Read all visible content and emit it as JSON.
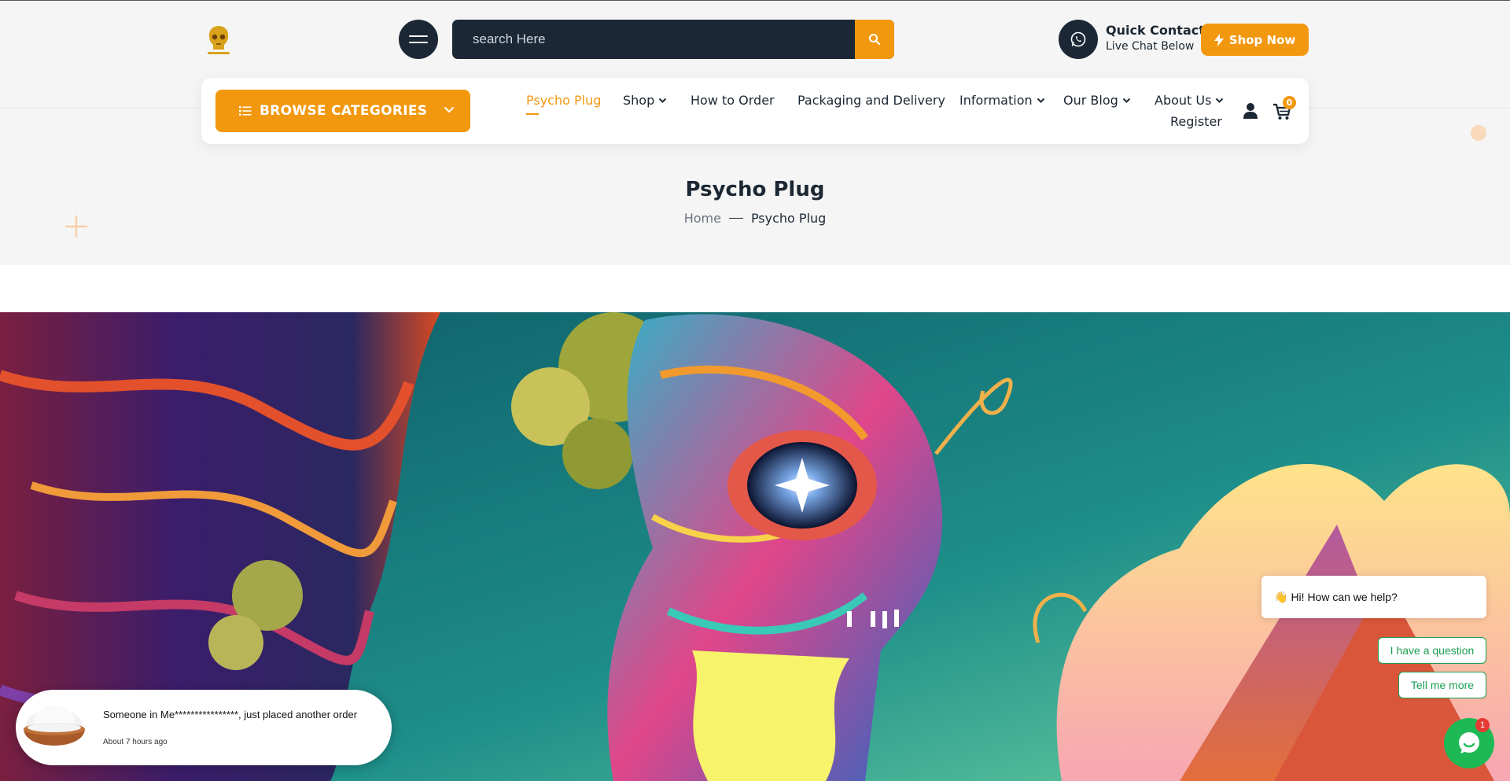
{
  "header": {
    "logo_icon": "skull-logo-icon",
    "search": {
      "placeholder": "search Here"
    },
    "quick_contact": {
      "title": "Quick Contact",
      "subtitle": "Live Chat Below"
    },
    "shop_now_label": "Shop Now"
  },
  "nav": {
    "browse_label": "BROWSE CATEGORIES",
    "items": [
      {
        "label": "Psycho Plug",
        "active": true
      },
      {
        "label": "Shop",
        "dropdown": true
      },
      {
        "label": "How to Order"
      },
      {
        "label": "Packaging and Delivery"
      },
      {
        "label": "Information",
        "dropdown": true
      },
      {
        "label": "Our Blog",
        "dropdown": true
      },
      {
        "label": "About Us",
        "dropdown": true
      }
    ],
    "register_label": "Register",
    "cart_count": "0"
  },
  "page": {
    "title": "Psycho Plug",
    "breadcrumb": {
      "home": "Home",
      "current": "Psycho Plug"
    }
  },
  "popup": {
    "message": "Someone in Me****************, just placed another order",
    "time": "About 7 hours ago"
  },
  "chat": {
    "greeting": "Hi! How can we help?",
    "options": [
      "I have a question",
      "Tell me more"
    ],
    "badge": "1"
  },
  "colors": {
    "accent": "#f2980f",
    "dark": "#1b2735",
    "chat_green": "#1db954"
  }
}
